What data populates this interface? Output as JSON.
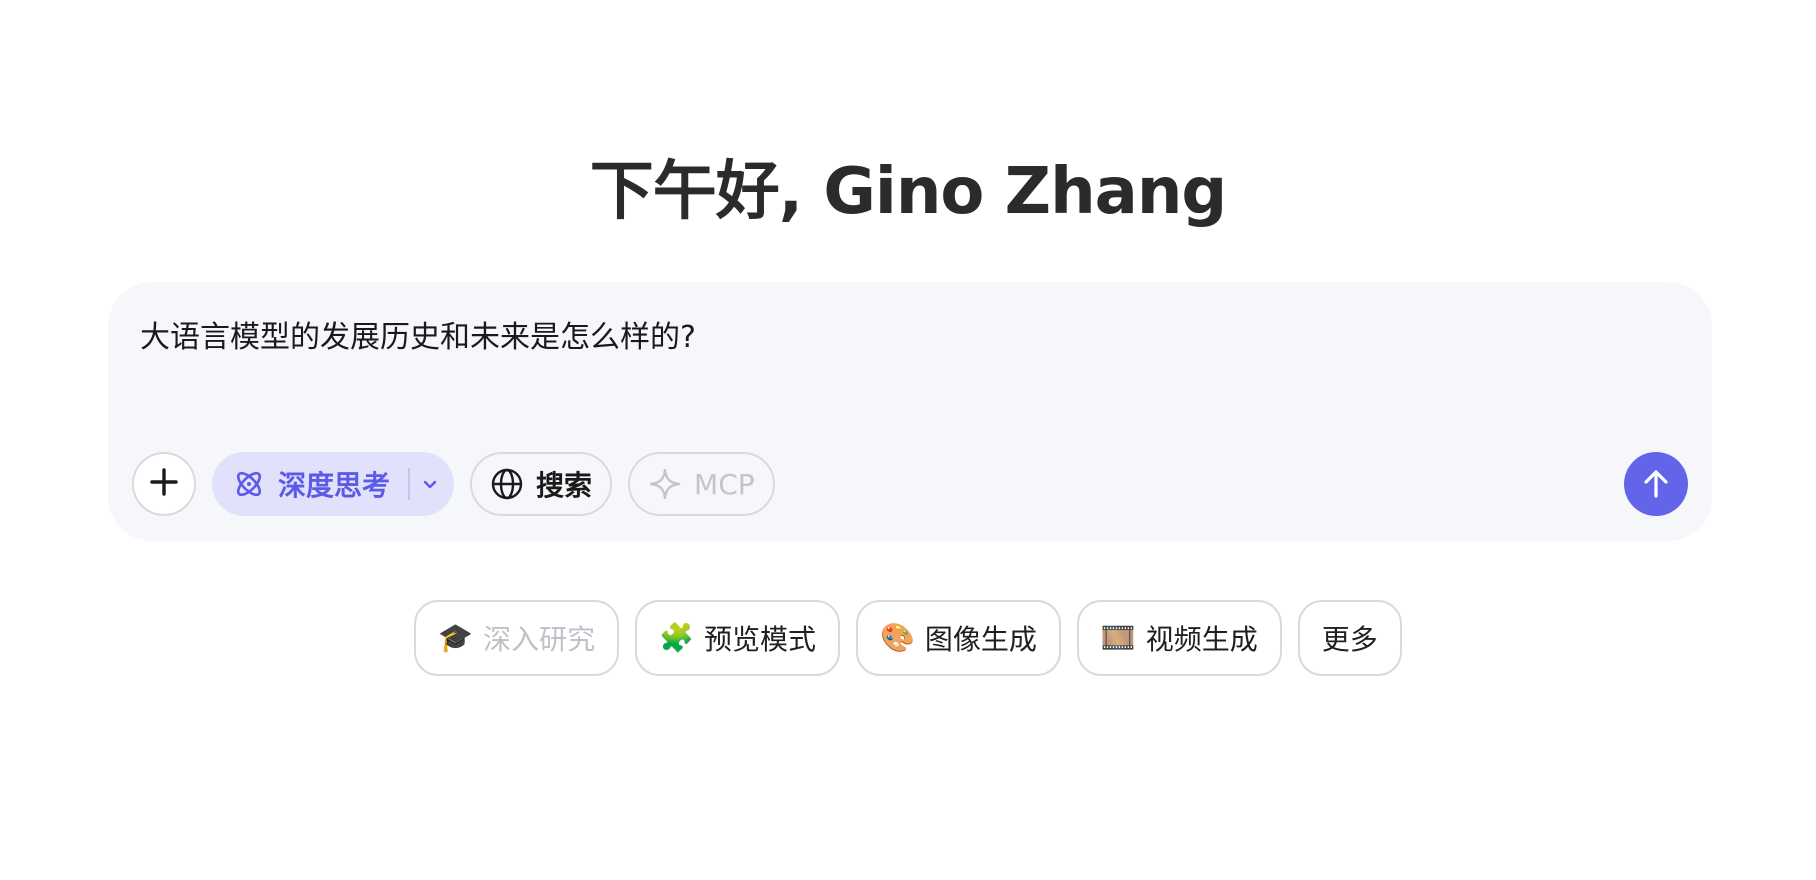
{
  "greeting": "下午好, Gino Zhang",
  "composer": {
    "text": "大语言模型的发展历史和未来是怎么样的?"
  },
  "toolbar": {
    "deep_think_label": "深度思考",
    "search_label": "搜索",
    "mcp_label": "MCP"
  },
  "quick_actions": [
    {
      "emoji": "🎓",
      "label": "深入研究"
    },
    {
      "emoji": "🧩",
      "label": "预览模式"
    },
    {
      "emoji": "🎨",
      "label": "图像生成"
    },
    {
      "emoji": "🎞️",
      "label": "视频生成"
    },
    {
      "emoji": "",
      "label": "更多"
    }
  ],
  "colors": {
    "accent": "#6464ea",
    "accent_soft": "#e1e1fb",
    "composer_bg": "#f6f7fb",
    "border": "#d9d9de"
  }
}
